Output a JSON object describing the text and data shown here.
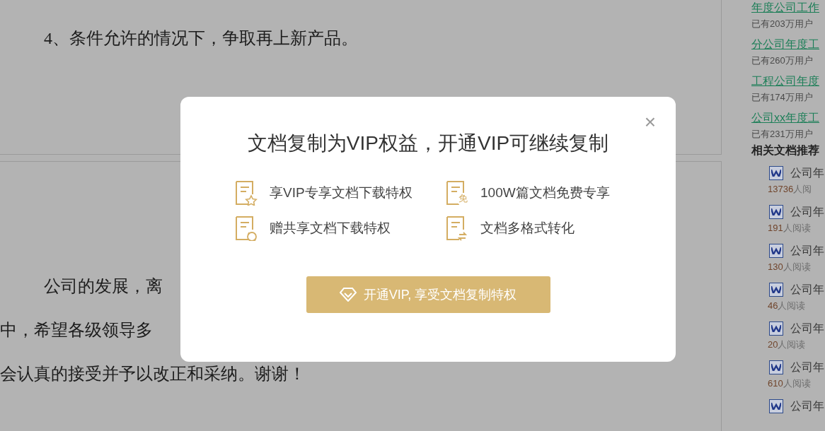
{
  "document": {
    "pages": [
      {
        "paragraphs": [
          {
            "text": "4、条件允许的情况下，争取再上新产品。",
            "indent": true
          }
        ]
      },
      {
        "paragraphs": [
          {
            "text": "公司的发展，离",
            "indent": true
          },
          {
            "text": "中，希望各级领导多",
            "indent": false
          },
          {
            "text": "会认真的接受并予以改正和采纳。谢谢！",
            "indent": false
          }
        ]
      }
    ]
  },
  "sidebar": {
    "top_links": [
      {
        "title": "年度公司工作",
        "users": "已有203万用户"
      },
      {
        "title": "分公司年度工",
        "users": "已有260万用户"
      },
      {
        "title": "工程公司年度",
        "users": "已有174万用户"
      },
      {
        "title": "公司xx年度工",
        "users": "已有231万用户"
      }
    ],
    "related_heading": "相关文档推荐",
    "related": [
      {
        "title": "公司年",
        "count": "13736",
        "suffix": "人阅"
      },
      {
        "title": "公司年",
        "count": "191",
        "suffix": "人阅读"
      },
      {
        "title": "公司年",
        "count": "130",
        "suffix": "人阅读"
      },
      {
        "title": "公司年",
        "count": "46",
        "suffix": "人阅读"
      },
      {
        "title": "公司年",
        "count": "20",
        "suffix": "人阅读"
      },
      {
        "title": "公司年",
        "count": "610",
        "suffix": "人阅读"
      },
      {
        "title": "公司年"
      }
    ]
  },
  "dialog": {
    "close": "×",
    "title": "文档复制为VIP权益，开通VIP可继续复制",
    "benefits": [
      {
        "kind": "star",
        "text": "享VIP专享文档下载特权"
      },
      {
        "kind": "free",
        "badge": "免",
        "text": "100W篇文档免费专享"
      },
      {
        "kind": "share",
        "text": "赠共享文档下载特权"
      },
      {
        "kind": "convert",
        "text": "文档多格式转化"
      }
    ],
    "button": "开通VIP, 享受文档复制特权"
  }
}
